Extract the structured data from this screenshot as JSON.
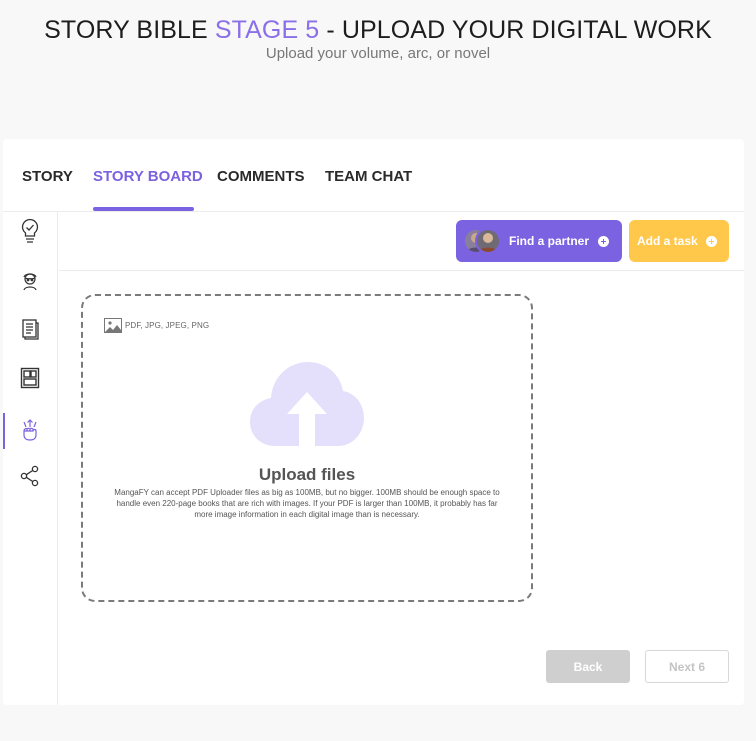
{
  "header": {
    "title_prefix": "STORY BIBLE ",
    "title_accent": "STAGE 5",
    "title_suffix": " - UPLOAD YOUR DIGITAL WORK",
    "subtitle": "Upload your volume, arc, or novel"
  },
  "tabs": [
    {
      "label": "STORY",
      "active": false
    },
    {
      "label": "STORY BOARD",
      "active": true
    },
    {
      "label": "COMMENTS",
      "active": false
    },
    {
      "label": "TEAM CHAT",
      "active": false
    }
  ],
  "sidebar": {
    "icons": [
      "lightbulb-check-icon",
      "character-icon",
      "document-icon",
      "storyboard-panels-icon",
      "hand-upload-icon",
      "share-icon"
    ],
    "active_index": 4
  },
  "actions": {
    "find_partner_label": "Find a partner",
    "add_task_label": "Add a task"
  },
  "upload": {
    "formats": "PDF, JPG, JPEG, PNG",
    "title": "Upload files",
    "description": "MangaFY can accept PDF Uploader files as big as 100MB, but no bigger. 100MB should be enough space to handle even 220-page books that are rich with images. If your PDF is larger than 100MB, it probably has far more image information in each digital image than is necessary."
  },
  "footer": {
    "back_label": "Back",
    "next_label": "Next 6"
  },
  "colors": {
    "accent": "#7b62e0",
    "task": "#ffc84a",
    "cloud": "#e4e0fb"
  }
}
